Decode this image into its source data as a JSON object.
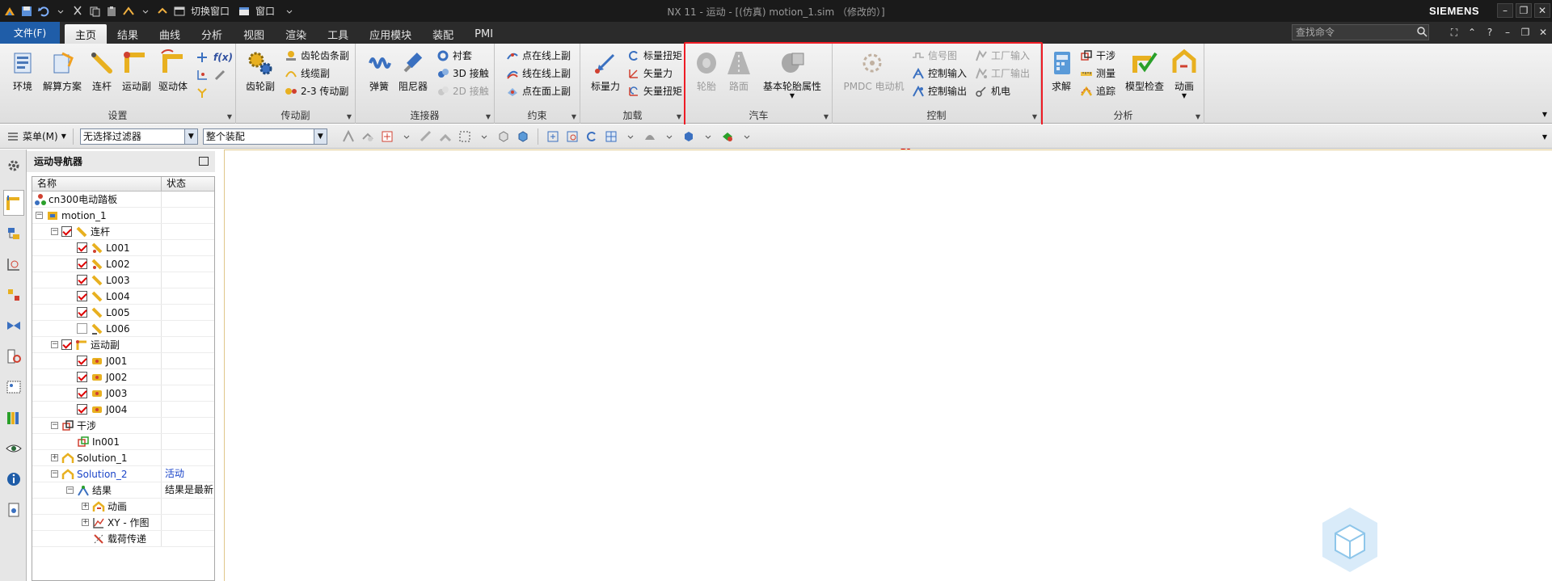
{
  "titlebar": {
    "window_title": "NX 11 - 运动 - [(仿真) motion_1.sim （修改的）]",
    "brand": "SIEMENS",
    "switch_window": "切换窗口",
    "window_menu": "窗口"
  },
  "tabs": {
    "file": "文件(F)",
    "items": [
      "主页",
      "结果",
      "曲线",
      "分析",
      "视图",
      "渲染",
      "工具",
      "应用模块",
      "装配",
      "PMI"
    ],
    "active": "主页"
  },
  "search": {
    "placeholder": "查找命令"
  },
  "ribbon": {
    "setup": {
      "label": "设置",
      "environment": "环境",
      "solution": "解算方案",
      "link": "连杆",
      "joint": "运动副",
      "driver": "驱动体"
    },
    "transmission": {
      "label": "传动副",
      "gear": "齿轮副",
      "rack_pinion": "齿轮齿条副",
      "cable": "线缆副",
      "two_three": "2-3 传动副"
    },
    "connector": {
      "label": "连接器",
      "spring": "弹簧",
      "damper": "阻尼器",
      "bushing": "衬套",
      "contact_3d": "3D 接触",
      "contact_2d": "2D 接触"
    },
    "constraint": {
      "label": "约束",
      "pt_on_curve": "点在线上副",
      "curve_on_curve": "线在线上副",
      "pt_on_surface": "点在面上副"
    },
    "load": {
      "label": "加载",
      "scalar_force": "标量力",
      "scalar_torque": "标量扭矩",
      "vector_force": "矢量力",
      "vector_torque": "矢量扭矩"
    },
    "vehicle": {
      "label": "汽车",
      "tire": "轮胎",
      "road": "路面",
      "tire_props": "基本轮胎属性"
    },
    "control": {
      "label": "控制",
      "pmdc": "PMDC 电动机",
      "signal_chart": "信号图",
      "ctrl_input": "控制输入",
      "ctrl_output": "控制输出",
      "plant_input": "工厂输入",
      "plant_output": "工厂输出",
      "mechatronics": "机电"
    },
    "analysis": {
      "label": "分析",
      "solve": "求解",
      "interference": "干涉",
      "measure": "测量",
      "trace": "追踪",
      "model_check": "模型检查",
      "animation": "动画"
    }
  },
  "selbar": {
    "menu": "菜单(M)",
    "filter": "无选择过滤器",
    "scope": "整个装配"
  },
  "navigator": {
    "title": "运动导航器",
    "col_name": "名称",
    "col_status": "状态",
    "rows": [
      {
        "label": "cn300电动踏板",
        "status": ""
      },
      {
        "label": "motion_1",
        "status": ""
      },
      {
        "label": "连杆",
        "status": ""
      },
      {
        "label": "L001",
        "status": ""
      },
      {
        "label": "L002",
        "status": ""
      },
      {
        "label": "L003",
        "status": ""
      },
      {
        "label": "L004",
        "status": ""
      },
      {
        "label": "L005",
        "status": ""
      },
      {
        "label": "L006",
        "status": ""
      },
      {
        "label": "运动副",
        "status": ""
      },
      {
        "label": "J001",
        "status": ""
      },
      {
        "label": "J002",
        "status": ""
      },
      {
        "label": "J003",
        "status": ""
      },
      {
        "label": "J004",
        "status": ""
      },
      {
        "label": "干涉",
        "status": ""
      },
      {
        "label": "In001",
        "status": ""
      },
      {
        "label": "Solution_1",
        "status": ""
      },
      {
        "label": "Solution_2",
        "status": "活动"
      },
      {
        "label": "结果",
        "status": "结果是最新"
      },
      {
        "label": "动画",
        "status": ""
      },
      {
        "label": "XY - 作图",
        "status": ""
      },
      {
        "label": "载荷传递",
        "status": ""
      }
    ]
  },
  "colors": {
    "accent": "#1f5da8",
    "highlight_box": "#ee1c25",
    "active_text": "#1a44c8"
  }
}
